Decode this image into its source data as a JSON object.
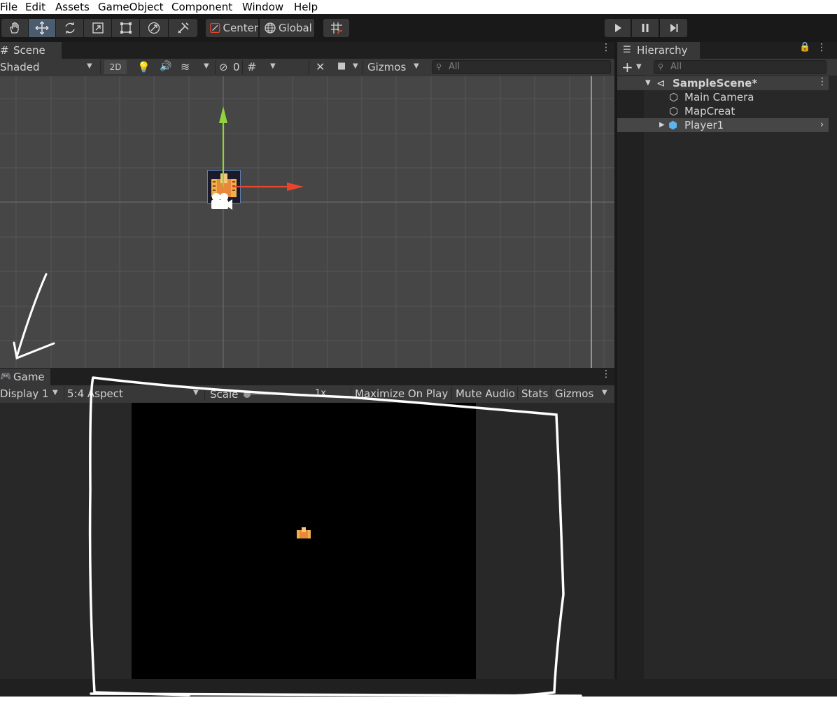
{
  "menu": [
    "File",
    "Edit",
    "Assets",
    "GameObject",
    "Component",
    "Window",
    "Help"
  ],
  "toolbar": {
    "pivot_mode": "Center",
    "pivot_rotation": "Global",
    "tools": [
      "hand-tool",
      "move-tool",
      "rotate-tool",
      "scale-tool",
      "rect-tool",
      "transform-tool",
      "custom-tool"
    ]
  },
  "scene": {
    "tab_label": "Scene",
    "shading_mode": "Shaded",
    "mode_2d": "2D",
    "hidden_count": "0",
    "gizmos_label": "Gizmos",
    "search_placeholder": "All"
  },
  "game": {
    "tab_label": "Game",
    "display": "Display 1",
    "aspect": "5:4 Aspect",
    "scale_label": "Scale",
    "scale_value": "1x",
    "maximize_label": "Maximize On Play",
    "mute_label": "Mute Audio",
    "stats_label": "Stats",
    "gizmos_label": "Gizmos"
  },
  "hierarchy": {
    "tab_label": "Hierarchy",
    "search_placeholder": "All",
    "scene_name": "SampleScene*",
    "items": [
      "Main Camera",
      "MapCreat",
      "Player1"
    ]
  },
  "colors": {
    "axis_x": "#e8452a",
    "axis_y": "#8fd43c",
    "selection": "#4b5c6e",
    "panel": "#282828",
    "game_view": "#000000",
    "annotation": "#ffffff"
  }
}
